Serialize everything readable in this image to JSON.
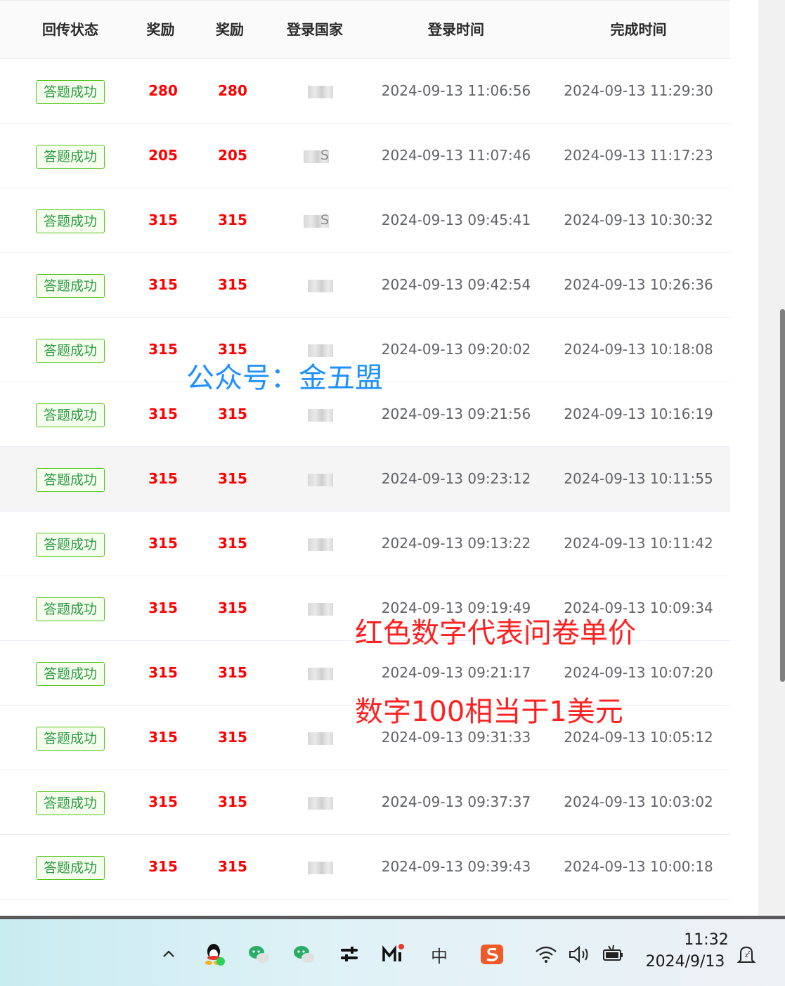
{
  "table": {
    "headers": {
      "status": "回传状态",
      "reward1": "奖励",
      "reward2": "奖励",
      "country": "登录国家",
      "login_time": "登录时间",
      "complete_time": "完成时间"
    },
    "rows": [
      {
        "status": "答题成功",
        "reward1": "280",
        "reward2": "280",
        "country_suffix": "",
        "login_time": "2024-09-13 11:06:56",
        "complete_time": "2024-09-13 11:29:30"
      },
      {
        "status": "答题成功",
        "reward1": "205",
        "reward2": "205",
        "country_suffix": "S",
        "login_time": "2024-09-13 11:07:46",
        "complete_time": "2024-09-13 11:17:23"
      },
      {
        "status": "答题成功",
        "reward1": "315",
        "reward2": "315",
        "country_suffix": "S",
        "login_time": "2024-09-13 09:45:41",
        "complete_time": "2024-09-13 10:30:32"
      },
      {
        "status": "答题成功",
        "reward1": "315",
        "reward2": "315",
        "country_suffix": "",
        "login_time": "2024-09-13 09:42:54",
        "complete_time": "2024-09-13 10:26:36"
      },
      {
        "status": "答题成功",
        "reward1": "315",
        "reward2": "315",
        "country_suffix": "",
        "login_time": "2024-09-13 09:20:02",
        "complete_time": "2024-09-13 10:18:08"
      },
      {
        "status": "答题成功",
        "reward1": "315",
        "reward2": "315",
        "country_suffix": "",
        "login_time": "2024-09-13 09:21:56",
        "complete_time": "2024-09-13 10:16:19"
      },
      {
        "status": "答题成功",
        "reward1": "315",
        "reward2": "315",
        "country_suffix": "",
        "login_time": "2024-09-13 09:23:12",
        "complete_time": "2024-09-13 10:11:55"
      },
      {
        "status": "答题成功",
        "reward1": "315",
        "reward2": "315",
        "country_suffix": "",
        "login_time": "2024-09-13 09:13:22",
        "complete_time": "2024-09-13 10:11:42"
      },
      {
        "status": "答题成功",
        "reward1": "315",
        "reward2": "315",
        "country_suffix": "",
        "login_time": "2024-09-13 09:19:49",
        "complete_time": "2024-09-13 10:09:34"
      },
      {
        "status": "答题成功",
        "reward1": "315",
        "reward2": "315",
        "country_suffix": "",
        "login_time": "2024-09-13 09:21:17",
        "complete_time": "2024-09-13 10:07:20"
      },
      {
        "status": "答题成功",
        "reward1": "315",
        "reward2": "315",
        "country_suffix": "",
        "login_time": "2024-09-13 09:31:33",
        "complete_time": "2024-09-13 10:05:12"
      },
      {
        "status": "答题成功",
        "reward1": "315",
        "reward2": "315",
        "country_suffix": "",
        "login_time": "2024-09-13 09:37:37",
        "complete_time": "2024-09-13 10:03:02"
      },
      {
        "status": "答题成功",
        "reward1": "315",
        "reward2": "315",
        "country_suffix": "",
        "login_time": "2024-09-13 09:39:43",
        "complete_time": "2024-09-13 10:00:18"
      }
    ]
  },
  "watermarks": {
    "public_account": "公众号：金五盟",
    "note1": "红色数字代表问卷单价",
    "note2": "数字100相当于1美元"
  },
  "taskbar": {
    "ime_label": "中",
    "time": "11:32",
    "date": "2024/9/13",
    "icons": [
      "chevron-up-icon",
      "qq-icon",
      "wechat-icon",
      "wechat-icon",
      "sliders-icon",
      "mi-icon",
      "ime-icon",
      "sogou-icon",
      "wifi-icon",
      "volume-icon",
      "battery-icon",
      "notification-icon"
    ]
  },
  "colors": {
    "reward": "#ff0000",
    "status_tag": "#52c41a",
    "watermark_blue": "#1e90ff",
    "watermark_red": "#ff2020"
  }
}
